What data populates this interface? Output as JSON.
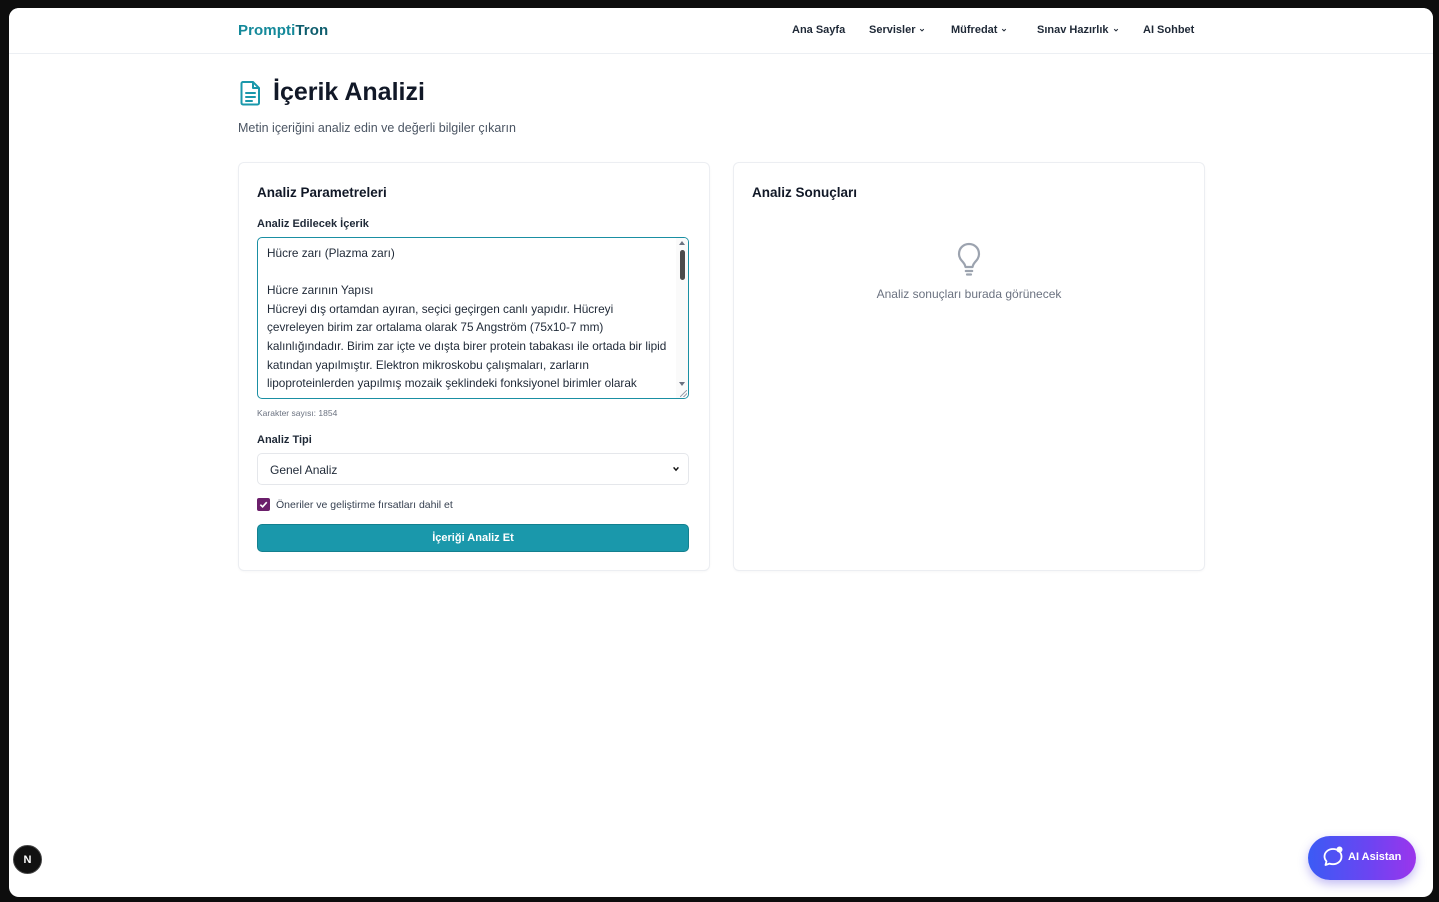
{
  "brand": {
    "part1": "Prompti",
    "part2": "Tron"
  },
  "nav": [
    {
      "label": "Ana Sayfa"
    },
    {
      "label": "Servisler"
    },
    {
      "label": "Müfredat"
    },
    {
      "label": "Sınav Hazırlık"
    },
    {
      "label": "AI Sohbet"
    }
  ],
  "page": {
    "title": "İçerik Analizi",
    "subtitle": "Metin içeriğini analiz edin ve değerli bilgiler çıkarın"
  },
  "params": {
    "title": "Analiz Parametreleri",
    "content_label": "Analiz Edilecek İçerik",
    "content_value": "Hücre zarı (Plazma zarı)\n\nHücre zarının Yapısı\nHücreyi dış ortamdan ayıran, seçici geçirgen canlı yapıdır. Hücreyi çevreleyen birim zar ortalama olarak 75 Angström (75x10-7 mm) kalınlığındadır. Birim zar içte ve dışta birer protein tabakası ile ortada bir lipid katından yapılmıştır. Elektron mikroskobu çalışmaları, zarların lipoproteinlerden yapılmış mozaik şeklindeki fonksiyonel birimler olarak",
    "char_count": "Karakter sayısı: 1854",
    "type_label": "Analiz Tipi",
    "type_value": "Genel Analiz",
    "checkbox_label": "Öneriler ve geliştirme fırsatları dahil et",
    "checkbox_checked": true,
    "submit_label": "İçeriği Analiz Et"
  },
  "results": {
    "title": "Analiz Sonuçları",
    "empty_text": "Analiz sonuçları burada görünecek"
  },
  "assistant": {
    "label": "AI Asistan"
  },
  "dev_badge": {
    "label": "N"
  },
  "colors": {
    "accent": "#1a98ab",
    "brand_dark": "#0e5d6d",
    "checkbox": "#6b1f6b",
    "assistant_gradient_start": "#3b5bf5",
    "assistant_gradient_end": "#9b35ec"
  },
  "icons": {
    "title": "document-icon",
    "empty": "lightbulb-icon",
    "assistant": "chat-bubble-icon"
  }
}
